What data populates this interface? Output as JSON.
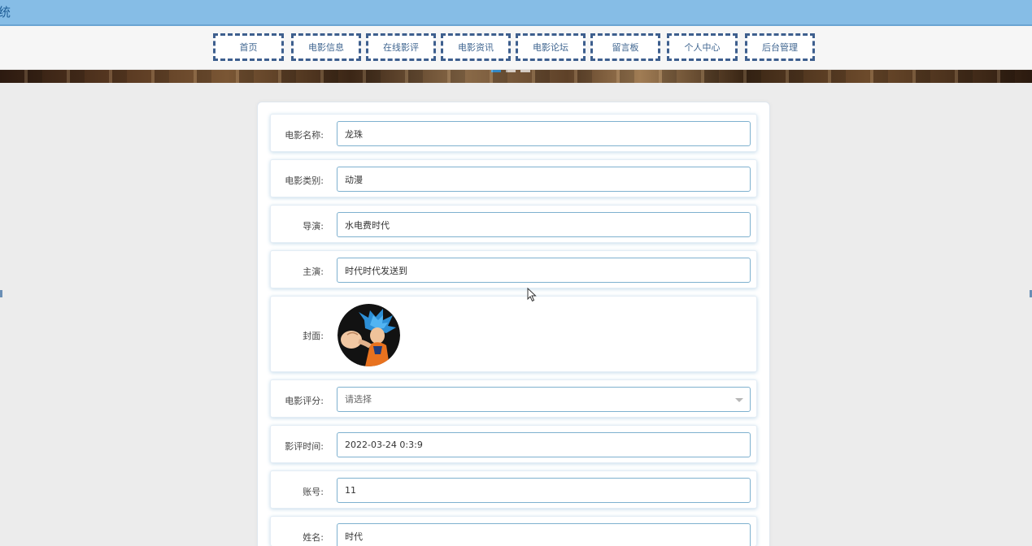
{
  "header": {
    "title": "统"
  },
  "nav": {
    "items": [
      {
        "label": "首页"
      },
      {
        "label": "电影信息"
      },
      {
        "label": "在线影评"
      },
      {
        "label": "电影资讯"
      },
      {
        "label": "电影论坛"
      },
      {
        "label": "留言板"
      },
      {
        "label": "个人中心"
      },
      {
        "label": "后台管理"
      }
    ]
  },
  "form": {
    "movie_name": {
      "label": "电影名称:",
      "value": "龙珠"
    },
    "movie_type": {
      "label": "电影类别:",
      "value": "动漫"
    },
    "director": {
      "label": "导演:",
      "value": "水电费时代"
    },
    "actor": {
      "label": "主演:",
      "value": "时代时代发送到"
    },
    "cover": {
      "label": "封面:",
      "image_icon": "anime-character-avatar-icon"
    },
    "rating": {
      "label": "电影评分:",
      "placeholder": "请选择"
    },
    "review_time": {
      "label": "影评时间:",
      "value": "2022-03-24 0:3:9"
    },
    "account": {
      "label": "账号:",
      "value": "11"
    },
    "name": {
      "label": "姓名:",
      "value": "时代"
    }
  },
  "colors": {
    "topbar": "#86bde6",
    "nav_border": "#3e5f8e",
    "input_border": "#7fb1cf"
  }
}
